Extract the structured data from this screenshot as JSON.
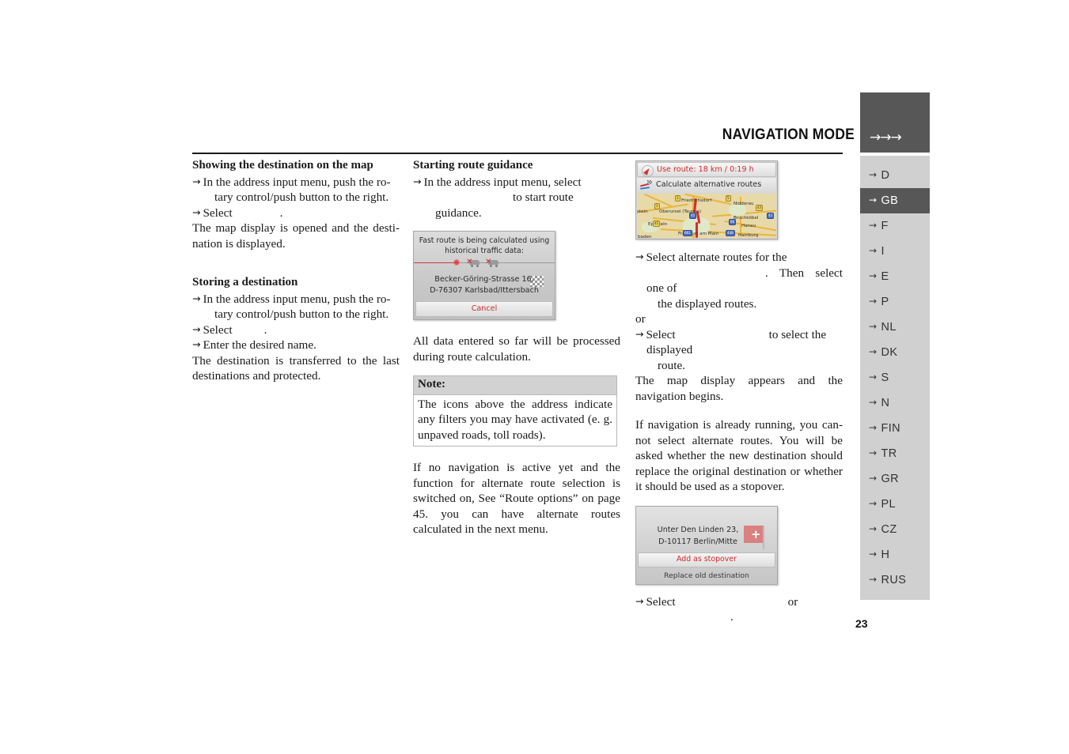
{
  "header": {
    "title": "NAVIGATION MODE",
    "arrows": "→→→"
  },
  "page_number": "23",
  "arrow_glyph": "→",
  "col1": {
    "heading_1": "Showing the destination on the map",
    "step_1a": "In the address input menu, push the ro-",
    "step_1a_cont": "tary control/push button to the right.",
    "step_1b_prefix": "Select",
    "step_1b_suffix": ".",
    "para_1": "The map display is opened and the desti-nation is displayed.",
    "heading_2": "Storing a destination",
    "step_2a": "In the address input menu, push the ro-",
    "step_2a_cont": "tary control/push button to the right.",
    "step_2b_prefix": "Select",
    "step_2b_suffix": ".",
    "step_2c": "Enter the desired name.",
    "para_2": "The destination is transferred to the last destinations and protected."
  },
  "col2": {
    "heading_1": "Starting route guidance",
    "step_1_prefix": "In the address input menu, select",
    "step_1_suffix": "to start route guidance.",
    "calc_shot": {
      "line_1": "Fast route is being calculated using",
      "line_2": "historical traffic data:",
      "address_line_1": "Becker-Göring-Strasse 16,",
      "address_line_2": "D-76307 Karlsbad/Ittersbach",
      "cancel_label": "Cancel"
    },
    "para_1": "All data entered so far will be processed during route calculation.",
    "note": {
      "title": "Note:",
      "body": "The icons above the address indicate any filters you may have activated (e. g. unpaved roads, toll roads)."
    },
    "para_2": "If no navigation is active yet and the function for alternate route selection is switched on, See “Route options” on page 45. you can have alternate routes calculated in the next menu."
  },
  "col3": {
    "route_shot": {
      "use_route_label": "Use route: 18 km / 0:19 h",
      "alt_routes_label": "Calculate alternative routes",
      "map_labels": [
        "Friedrichsdorf",
        "Nidderau",
        "Oberursel (Taunus)",
        "Bruchköbel",
        "Eppstein",
        "Hanau",
        "Frankfurt am Main",
        "Hainburg",
        "baden",
        "stein"
      ],
      "map_shields": [
        "3",
        "5",
        "45",
        "66",
        "3",
        "43",
        "661",
        "448",
        "45",
        "43"
      ]
    },
    "step_1_prefix": "Select alternate routes for the",
    "step_1_mid": ". Then select one of",
    "step_1_cont": "the displayed routes.",
    "or_label": "or",
    "step_2_prefix": "Select",
    "step_2_suffix": "to select the displayed",
    "step_2_cont": "route.",
    "para_1": "The map display appears and the navigation begins.",
    "para_2": "If navigation is already running, you can-not select alternate routes. You will be asked whether the new destination should replace the original destination or whether it should be used as a stopover.",
    "stopover_shot": {
      "address_line_1": "Unter Den Linden 23,",
      "address_line_2": "D-10117 Berlin/Mitte",
      "add_stopover_label": "Add as stopover",
      "replace_label": "Replace old destination"
    },
    "step_3_prefix": "Select",
    "step_3_mid": "or",
    "step_3_suffix": "."
  },
  "sidebar": {
    "items": [
      {
        "label": "D",
        "active": false
      },
      {
        "label": "GB",
        "active": true
      },
      {
        "label": "F",
        "active": false
      },
      {
        "label": "I",
        "active": false
      },
      {
        "label": "E",
        "active": false
      },
      {
        "label": "P",
        "active": false
      },
      {
        "label": "NL",
        "active": false
      },
      {
        "label": "DK",
        "active": false
      },
      {
        "label": "S",
        "active": false
      },
      {
        "label": "N",
        "active": false
      },
      {
        "label": "FIN",
        "active": false
      },
      {
        "label": "TR",
        "active": false
      },
      {
        "label": "GR",
        "active": false
      },
      {
        "label": "PL",
        "active": false
      },
      {
        "label": "CZ",
        "active": false
      },
      {
        "label": "H",
        "active": false
      },
      {
        "label": "RUS",
        "active": false
      }
    ]
  }
}
